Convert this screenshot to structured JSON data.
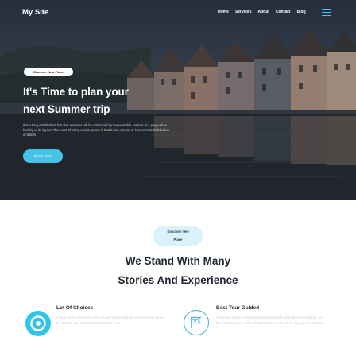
{
  "brand": "My Site",
  "nav": {
    "items": [
      {
        "label": "Home"
      },
      {
        "label": "Services"
      },
      {
        "label": "About"
      },
      {
        "label": "Contact"
      },
      {
        "label": "Blog"
      }
    ]
  },
  "hero": {
    "tag": "Discover New Place",
    "title_line1": "It's Time to plan your",
    "title_line2": "next Summer trip",
    "text": "It is a long established fact that a reader will be distracted by the readable content of a page when looking at its layout. The point of using Lorem Ipsum is that it has a more-or-less normal distribution of letters",
    "button": "Read More"
  },
  "section": {
    "tag_line1": "Discover new",
    "tag_line2": "Place",
    "title_line1": "We Stand With Many",
    "title_line2": "Stories And Experience"
  },
  "features": [
    {
      "title": "Lot Of Choices",
      "text": "Lorem Ipsum has been the industry's standard dummy text ever since the 1500s, when an unknown printer took",
      "icon": "compass-icon"
    },
    {
      "title": "Best Tour Guided",
      "text": "There are many variations of passages of Lorem Ipsum available, but the majority have suffered alteration in some form, by injected humour",
      "icon": "flag-icon"
    }
  ],
  "colors": {
    "accent": "#2fc5e8",
    "pill_bg": "#daf2fb",
    "hamburger": "#2fd2e8"
  }
}
